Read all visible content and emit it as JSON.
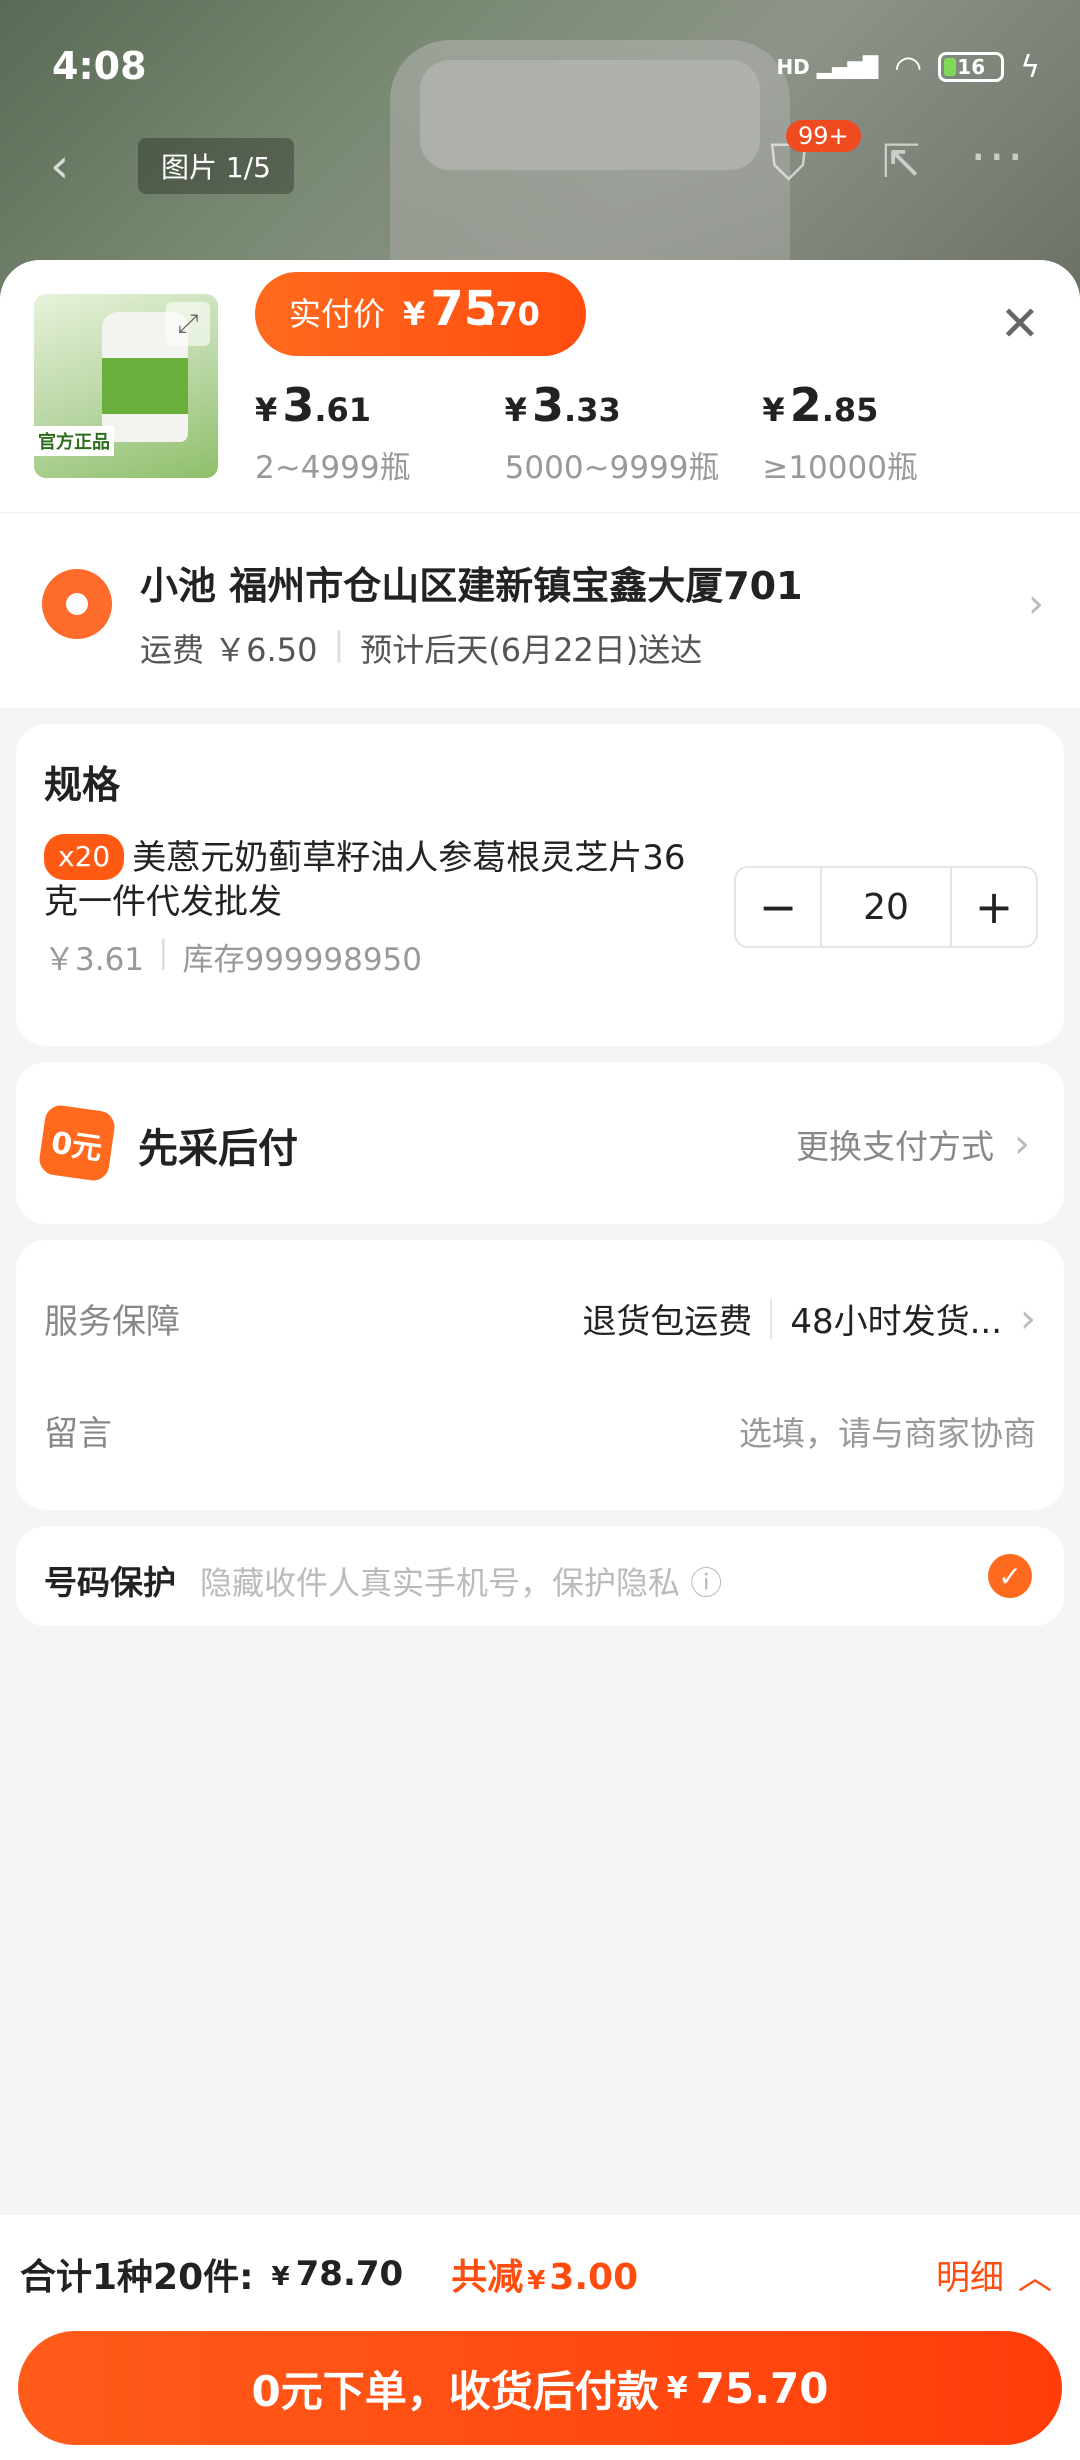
{
  "status_bar": {
    "time": "4:08",
    "network": "HD",
    "battery": "16"
  },
  "bg_page": {
    "image_counter": "图片 1/5",
    "cart_badge": "99+"
  },
  "product": {
    "tag": "官方正品",
    "pay_price_label": "实付价",
    "pay_price_symbol": "¥",
    "pay_price_int": "75",
    "pay_price_dec": ".70",
    "tiers": [
      {
        "symbol": "¥",
        "int": "3",
        "dec": ".61",
        "qty": "2~4999瓶"
      },
      {
        "symbol": "¥",
        "int": "3",
        "dec": ".33",
        "qty": "5000~9999瓶"
      },
      {
        "symbol": "¥",
        "int": "2",
        "dec": ".85",
        "qty": "≥10000瓶"
      }
    ]
  },
  "address": {
    "line1": "小池 福州市仓山区建新镇宝鑫大厦701",
    "freight": "运费 ￥6.50",
    "eta": "预计后天(6月22日)送达"
  },
  "spec": {
    "title": "规格",
    "qty_badge": "x20",
    "name": "美蒽元奶蓟草籽油人参葛根灵芝片36克一件代发批发",
    "price": "￥3.61",
    "stock": "库存999998950",
    "quantity": "20"
  },
  "payment": {
    "icon_text": "0元",
    "label": "先采后付",
    "change": "更换支付方式"
  },
  "service": {
    "label": "服务保障",
    "values": [
      "退货包运费",
      "48小时发货..."
    ],
    "note_label": "留言",
    "note_placeholder": "选填，请与商家协商"
  },
  "privacy": {
    "label": "号码保护",
    "desc": "隐藏收件人真实手机号，保护隐私"
  },
  "footer": {
    "total_label": "合计1种20件:",
    "total_symbol": "¥",
    "total_amount": "78.70",
    "discount_label": "共减",
    "discount_symbol": "¥",
    "discount_amount": "3.00",
    "detail": "明细",
    "submit_label": "0元下单，收货后付款",
    "submit_symbol": "¥",
    "submit_amount": "75.70"
  },
  "colors": {
    "accent": "#ff5a14",
    "accent_dark": "#ff3d0a"
  }
}
